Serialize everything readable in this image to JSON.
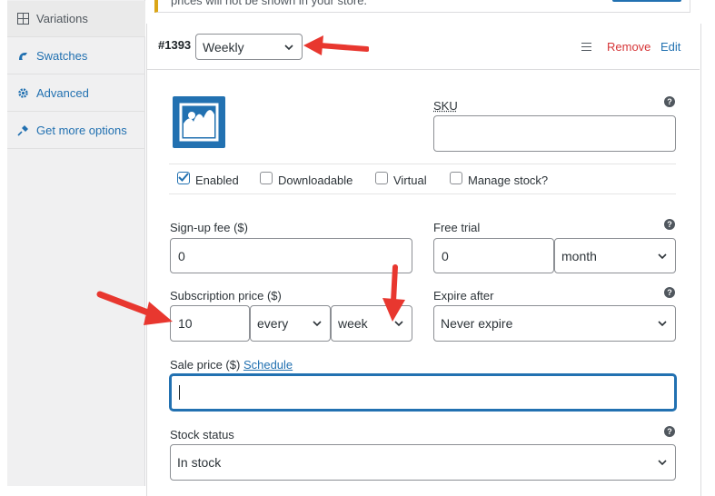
{
  "sidebar": {
    "items": [
      {
        "label": "Variations",
        "icon": "grid-icon"
      },
      {
        "label": "Swatches",
        "icon": "swatches-icon"
      },
      {
        "label": "Advanced",
        "icon": "gear-icon"
      },
      {
        "label": "Get more options",
        "icon": "plug-icon"
      }
    ]
  },
  "notice": {
    "text": "prices will not be shown in your store."
  },
  "variation": {
    "id": "#1393",
    "attribute_value": "Weekly",
    "remove_label": "Remove",
    "edit_label": "Edit"
  },
  "fields": {
    "sku": {
      "label": "SKU",
      "value": ""
    },
    "enabled": {
      "label": "Enabled",
      "checked": true
    },
    "downloadable": {
      "label": "Downloadable",
      "checked": false
    },
    "virtual": {
      "label": "Virtual",
      "checked": false
    },
    "manage_stock": {
      "label": "Manage stock?",
      "checked": false
    },
    "signup_fee": {
      "label": "Sign-up fee ($)",
      "value": "0"
    },
    "free_trial": {
      "label": "Free trial",
      "value": "0",
      "period": "month"
    },
    "subscription_price": {
      "label": "Subscription price ($)",
      "value": "10",
      "interval": "every",
      "period": "week"
    },
    "expire_after": {
      "label": "Expire after",
      "value": "Never expire"
    },
    "sale_price": {
      "label": "Sale price ($)",
      "schedule_link": "Schedule",
      "value": ""
    },
    "stock_status": {
      "label": "Stock status",
      "value": "In stock"
    }
  },
  "colors": {
    "accent": "#2271b1",
    "danger": "#d63638",
    "annotation_arrow": "#e8372f"
  }
}
